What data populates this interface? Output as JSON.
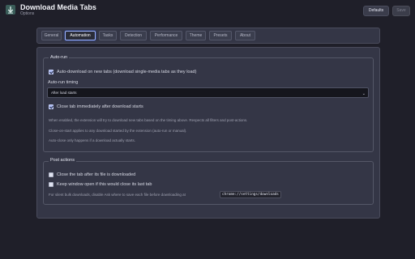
{
  "header": {
    "title": "Download Media Tabs",
    "subtitle": "Options",
    "defaults_label": "Defaults",
    "save_label": "Save"
  },
  "tabs": [
    {
      "label": "General",
      "active": false
    },
    {
      "label": "Automation",
      "active": true
    },
    {
      "label": "Tasks",
      "active": false
    },
    {
      "label": "Detection",
      "active": false
    },
    {
      "label": "Performance",
      "active": false
    },
    {
      "label": "Theme",
      "active": false
    },
    {
      "label": "Presets",
      "active": false
    },
    {
      "label": "About",
      "active": false
    }
  ],
  "autorun": {
    "legend": "Auto-run",
    "auto_download_label": "Auto-download on new tabs (download single-media tabs as they load)",
    "auto_download_checked": true,
    "timing_label": "Auto-run timing",
    "timing_value": "After load starts",
    "close_tab_label": "Close tab immediately after download starts",
    "close_tab_checked": true,
    "help1": "When enabled, the extension will try to download new tabs based on the timing above. Respects all filters and post-actions.",
    "help2": "Close-on-start applies to any download started by the extension (auto-run or manual).",
    "help3": "Auto-close only happens if a download actually starts."
  },
  "post_actions": {
    "legend": "Post actions",
    "close_after_label": "Close the tab after its file is downloaded",
    "close_after_checked": false,
    "keep_window_label": "Keep window open if this would close its last tab",
    "keep_window_checked": false,
    "help_prefix": "For silent bulk downloads, disable Ask where to save each file before downloading at",
    "help_code": "chrome://settings/downloads"
  },
  "colors": {
    "background": "#1f1f29",
    "panel": "#343646",
    "active_tab_border": "#9fb5ff",
    "checkbox_on": "#a9b8f0"
  }
}
